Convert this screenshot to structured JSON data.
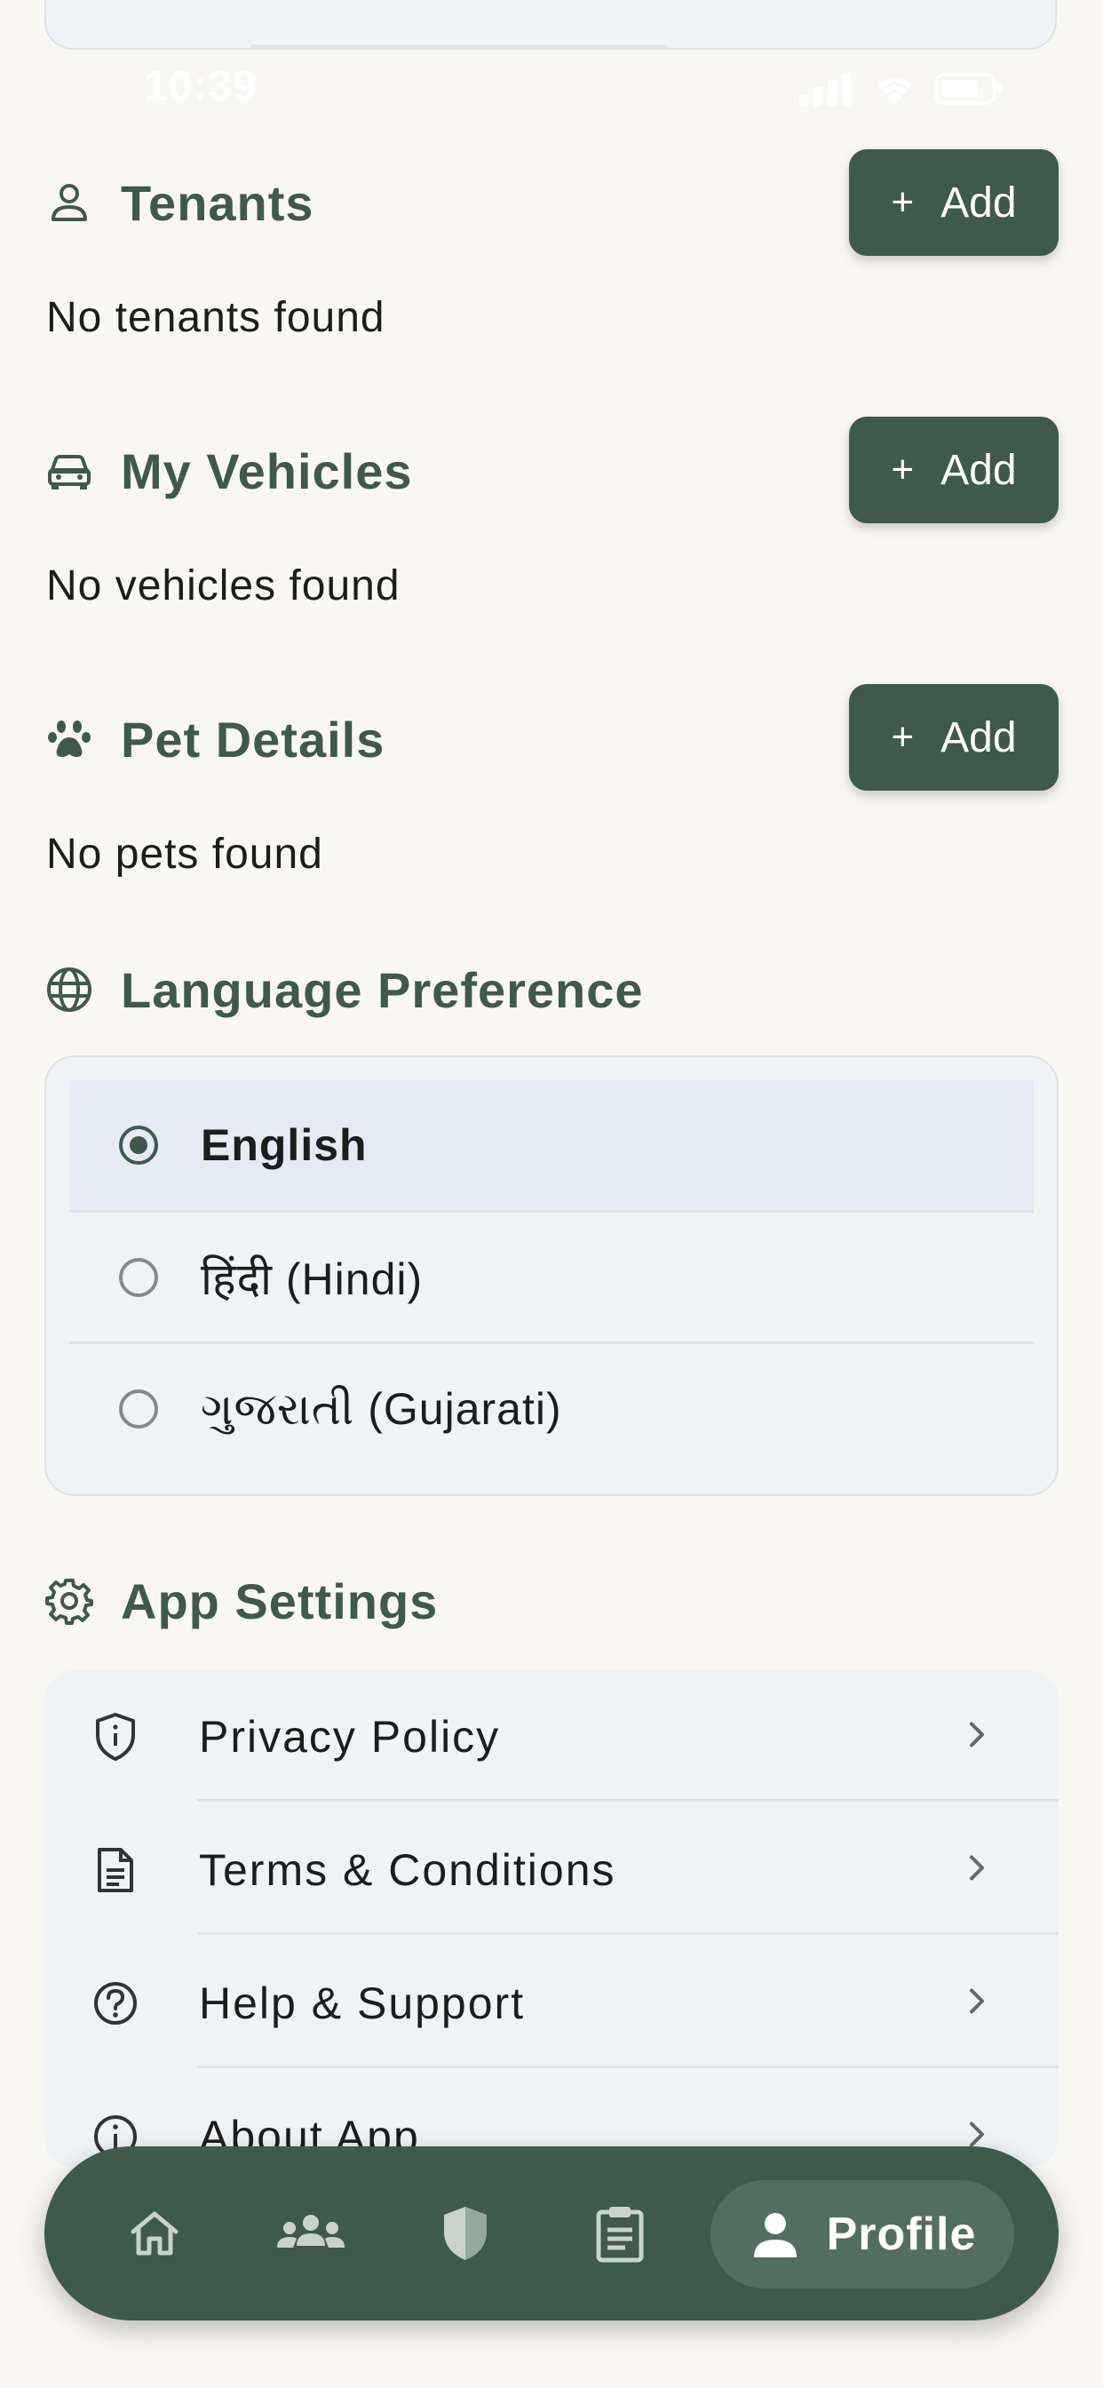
{
  "status_bar": {
    "time": "10:39"
  },
  "sections": {
    "tenants": {
      "title": "Tenants",
      "add_label": "Add",
      "empty_text": "No tenants found"
    },
    "vehicles": {
      "title": "My Vehicles",
      "add_label": "Add",
      "empty_text": "No vehicles found"
    },
    "pets": {
      "title": "Pet Details",
      "add_label": "Add",
      "empty_text": "No pets found"
    }
  },
  "language": {
    "title": "Language Preference",
    "options": [
      {
        "label": "English",
        "selected": true
      },
      {
        "label": "हिंदी (Hindi)",
        "selected": false
      },
      {
        "label": "ગુજરાતી (Gujarati)",
        "selected": false
      }
    ]
  },
  "app_settings": {
    "title": "App Settings",
    "items": [
      {
        "label": "Privacy Policy",
        "icon": "shield-info-icon"
      },
      {
        "label": "Terms & Conditions",
        "icon": "document-icon"
      },
      {
        "label": "Help & Support",
        "icon": "help-circle-icon"
      },
      {
        "label": "About App",
        "icon": "info-circle-icon"
      }
    ]
  },
  "bottom_nav": {
    "items": [
      {
        "icon": "home-icon",
        "active": false
      },
      {
        "icon": "community-icon",
        "active": false
      },
      {
        "icon": "security-shield-icon",
        "active": false
      },
      {
        "icon": "clipboard-icon",
        "active": false
      },
      {
        "icon": "profile-icon",
        "label": "Profile",
        "active": true
      }
    ]
  },
  "colors": {
    "primary": "#3e5a4c",
    "background": "#f9f7f4",
    "card": "#f0f3f6",
    "selected_row": "#e6eaf5"
  }
}
